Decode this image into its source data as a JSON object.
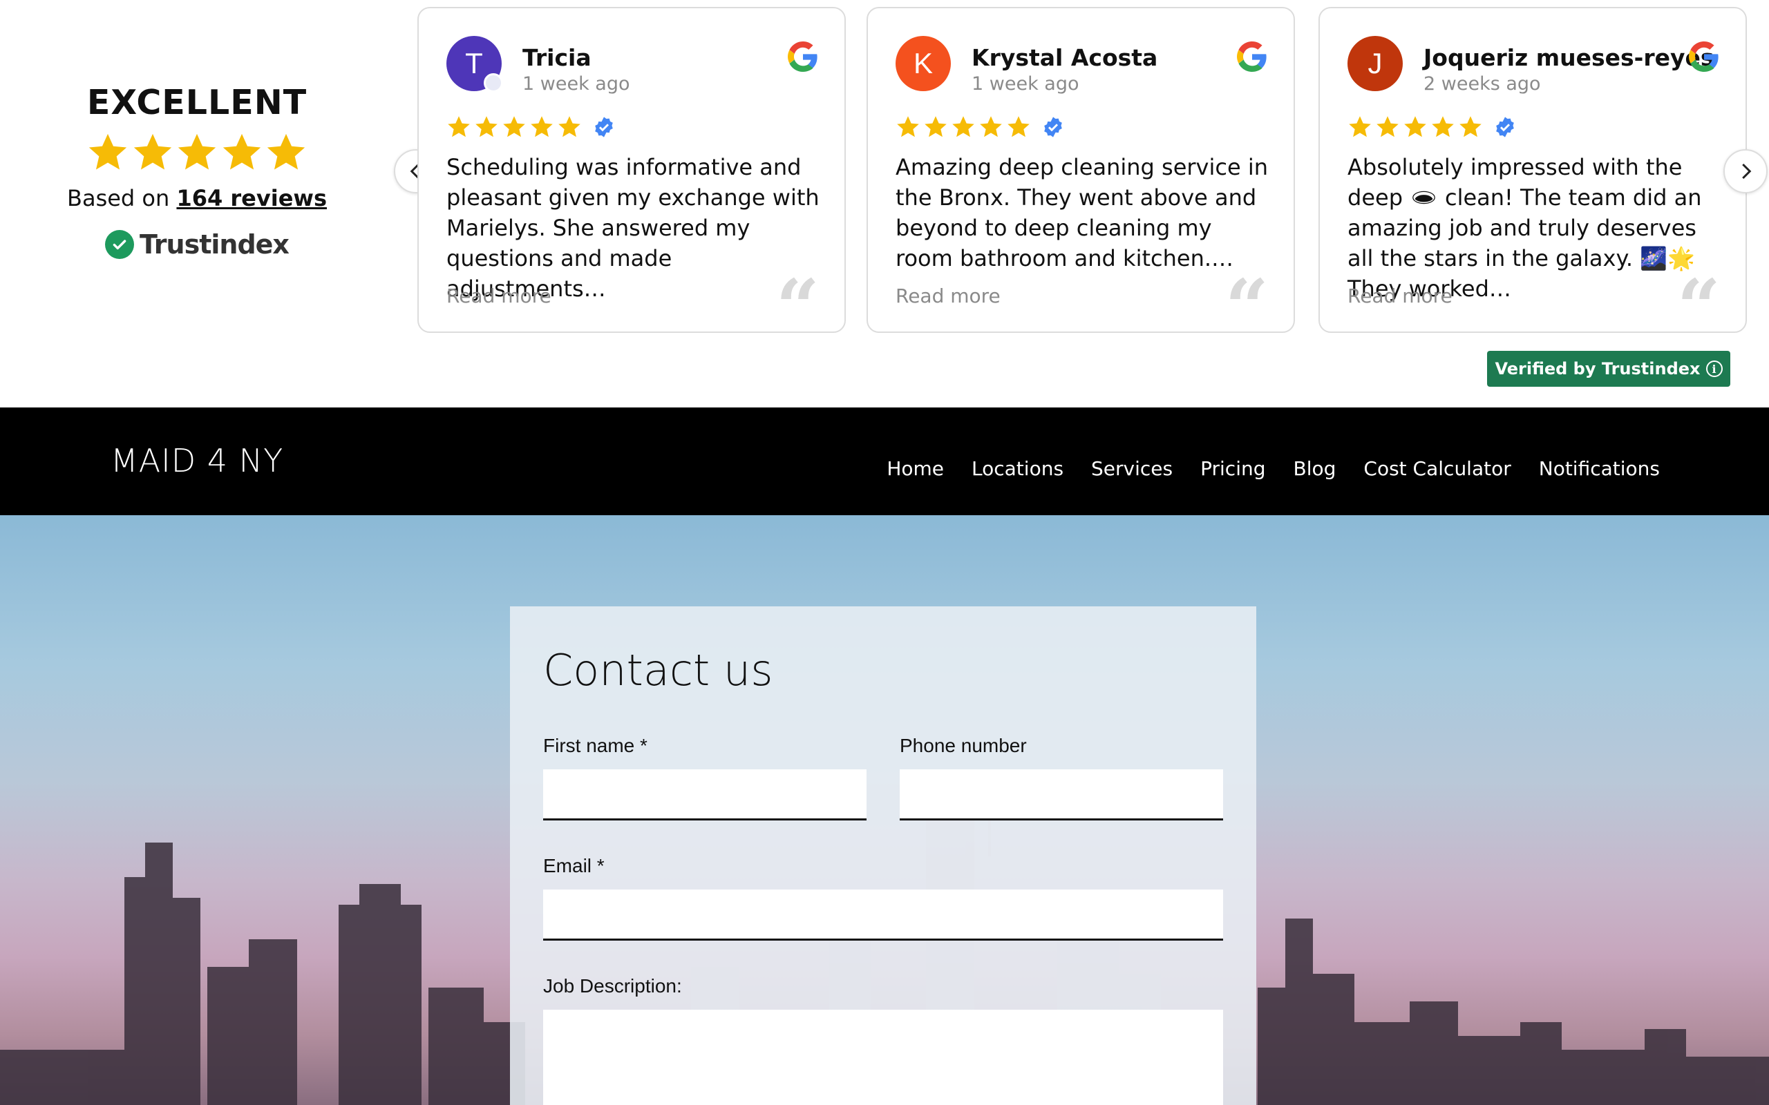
{
  "summary": {
    "rating_word": "EXCELLENT",
    "stars": 5,
    "based_on": "Based on",
    "review_count": "164 reviews",
    "brand": "Trustindex"
  },
  "reviews": [
    {
      "initial": "T",
      "name": "Tricia",
      "time": "1 week ago",
      "avatar_color": "#4e36b8",
      "text": "Scheduling was informative and pleasant given my exchange with Marielys. She answered my questions and made adjustments…",
      "read_more": "Read more"
    },
    {
      "initial": "K",
      "name": "Krystal Acosta",
      "time": "1 week ago",
      "avatar_color": "#f4511e",
      "text": "Amazing deep cleaning service in the Bronx. They went above and beyond to deep cleaning my room bathroom and kitchen.…",
      "read_more": "Read more"
    },
    {
      "initial": "J",
      "name": "Joqueriz mueses-reyes",
      "time": "2 weeks ago",
      "avatar_color": "#c0360c",
      "text": "Absolutely impressed with the deep 🕳 clean! The team did an amazing job and truly deserves all the stars in the galaxy. 🌌🌟  They worked…",
      "read_more": "Read more"
    }
  ],
  "verified_button": "Verified by Trustindex",
  "nav": {
    "logo": "MAID 4 NY",
    "items": [
      "Home",
      "Locations",
      "Services",
      "Pricing",
      "Blog",
      "Cost Calculator",
      "Notifications"
    ]
  },
  "form": {
    "title": "Contact us",
    "first_name_label": "First name *",
    "phone_label": "Phone number",
    "email_label": "Email *",
    "job_label": "Job Description:"
  },
  "colors": {
    "star": "#f6bb06",
    "verified_green": "#1d7a51",
    "nav_bg": "#000000"
  }
}
